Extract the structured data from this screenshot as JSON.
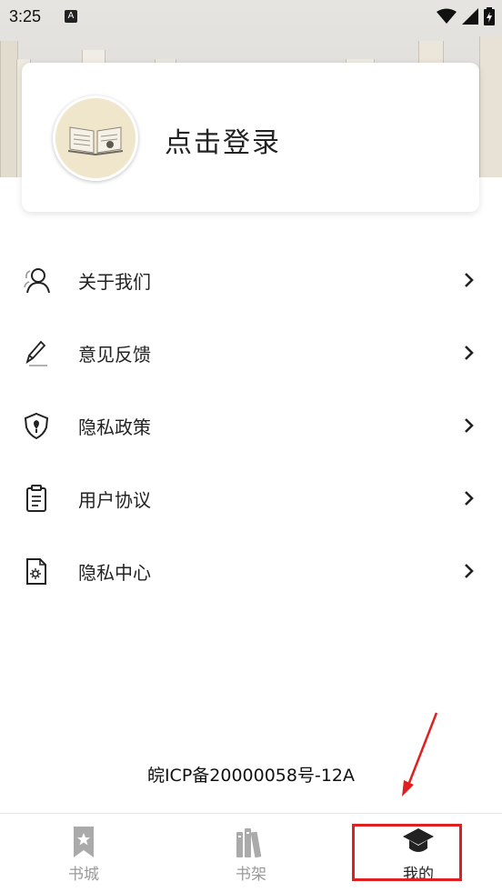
{
  "status_bar": {
    "time": "3:25",
    "notification_icon": "A"
  },
  "login": {
    "label": "点击登录"
  },
  "menu": {
    "items": [
      {
        "label": "关于我们",
        "icon": "person-icon"
      },
      {
        "label": "意见反馈",
        "icon": "pencil-icon"
      },
      {
        "label": "隐私政策",
        "icon": "shield-icon"
      },
      {
        "label": "用户协议",
        "icon": "clipboard-icon"
      },
      {
        "label": "隐私中心",
        "icon": "document-gear-icon"
      }
    ]
  },
  "footer": {
    "icp": "皖ICP备20000058号-12A"
  },
  "nav": {
    "items": [
      {
        "label": "书城",
        "icon": "bookmark-icon",
        "active": false
      },
      {
        "label": "书架",
        "icon": "bookshelf-icon",
        "active": false
      },
      {
        "label": "我的",
        "icon": "graduation-cap-icon",
        "active": true
      }
    ]
  },
  "colors": {
    "accent": "#e02020",
    "text": "#222222",
    "inactive": "#999999"
  }
}
